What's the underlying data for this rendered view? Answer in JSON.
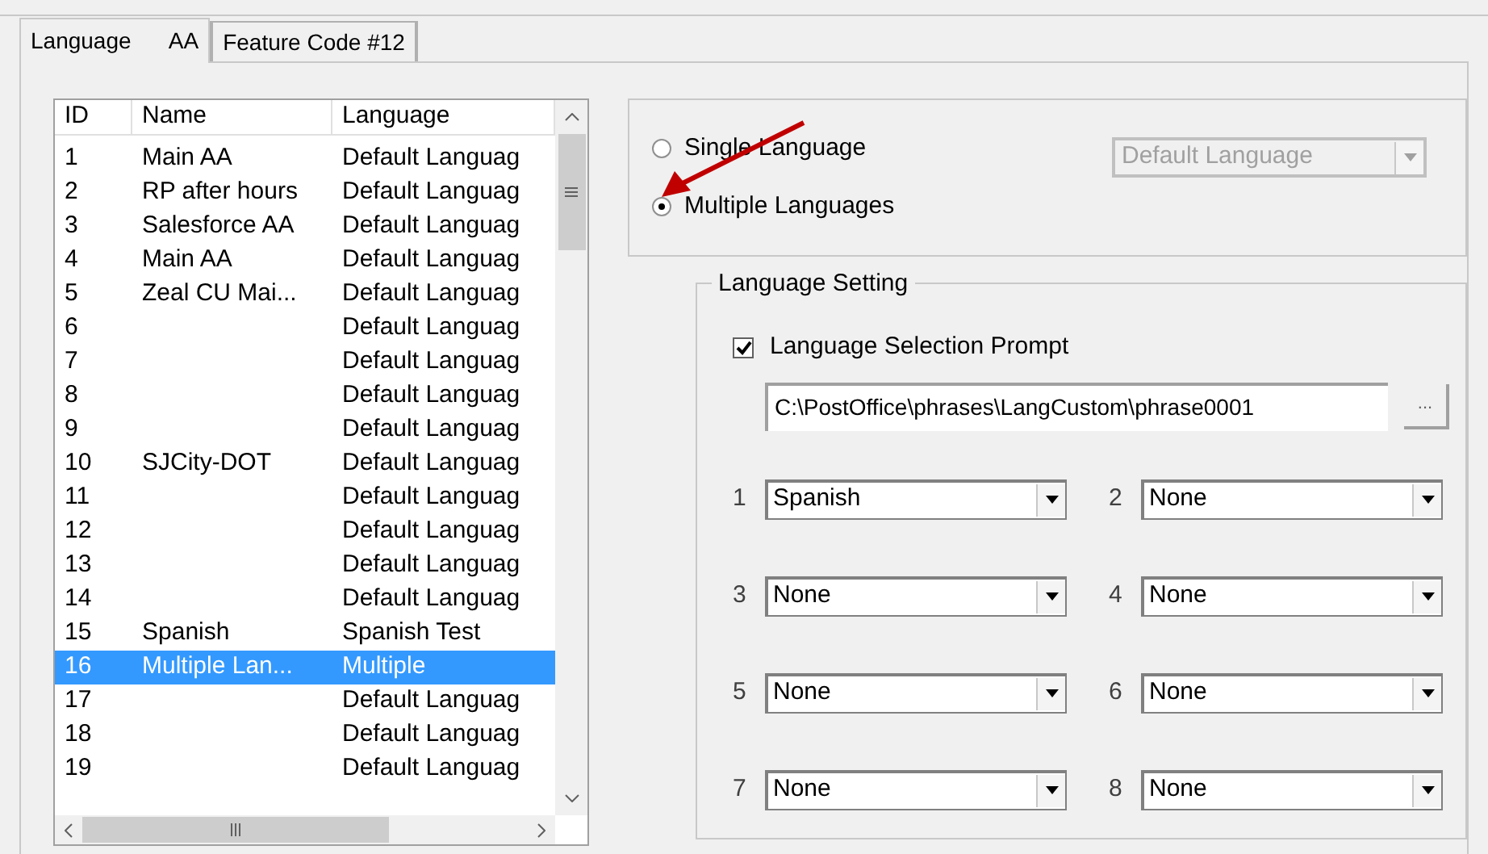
{
  "tabs": [
    {
      "label": "Language AA",
      "selected": true
    },
    {
      "label": "Feature Code #12",
      "selected": false
    }
  ],
  "list": {
    "columns": [
      "ID",
      "Name",
      "Language"
    ],
    "rows": [
      {
        "id": "1",
        "name": "Main AA",
        "language": "Default Languag",
        "selected": false
      },
      {
        "id": "2",
        "name": "RP after hours",
        "language": "Default Languag",
        "selected": false
      },
      {
        "id": "3",
        "name": "Salesforce AA",
        "language": "Default Languag",
        "selected": false
      },
      {
        "id": "4",
        "name": "Main AA",
        "language": "Default Languag",
        "selected": false
      },
      {
        "id": "5",
        "name": "Zeal CU Mai...",
        "language": "Default Languag",
        "selected": false
      },
      {
        "id": "6",
        "name": "",
        "language": "Default Languag",
        "selected": false
      },
      {
        "id": "7",
        "name": "",
        "language": "Default Languag",
        "selected": false
      },
      {
        "id": "8",
        "name": "",
        "language": "Default Languag",
        "selected": false
      },
      {
        "id": "9",
        "name": "",
        "language": "Default Languag",
        "selected": false
      },
      {
        "id": "10",
        "name": "SJCity-DOT",
        "language": "Default Languag",
        "selected": false
      },
      {
        "id": "11",
        "name": "",
        "language": "Default Languag",
        "selected": false
      },
      {
        "id": "12",
        "name": "",
        "language": "Default Languag",
        "selected": false
      },
      {
        "id": "13",
        "name": "",
        "language": "Default Languag",
        "selected": false
      },
      {
        "id": "14",
        "name": "",
        "language": "Default Languag",
        "selected": false
      },
      {
        "id": "15",
        "name": "Spanish",
        "language": "Spanish Test",
        "selected": false
      },
      {
        "id": "16",
        "name": "Multiple Lan...",
        "language": "Multiple",
        "selected": true
      },
      {
        "id": "17",
        "name": "",
        "language": "Default Languag",
        "selected": false
      },
      {
        "id": "18",
        "name": "",
        "language": "Default Languag",
        "selected": false
      },
      {
        "id": "19",
        "name": "",
        "language": "Default Languag",
        "selected": false
      }
    ]
  },
  "mode": {
    "options": [
      {
        "label": "Single Language",
        "selected": false
      },
      {
        "label": "Multiple Languages",
        "selected": true
      }
    ],
    "single_language_dropdown": {
      "value": "Default Language",
      "disabled": true
    }
  },
  "language_setting": {
    "title": "Language Setting",
    "prompt_checkbox": {
      "label": "Language Selection Prompt",
      "checked": true
    },
    "prompt_path": "C:\\PostOffice\\phrases\\LangCustom\\phrase0001",
    "browse_button": "...",
    "slots": [
      {
        "number": "1",
        "value": "Spanish"
      },
      {
        "number": "2",
        "value": "None"
      },
      {
        "number": "3",
        "value": "None"
      },
      {
        "number": "4",
        "value": "None"
      },
      {
        "number": "5",
        "value": "None"
      },
      {
        "number": "6",
        "value": "None"
      },
      {
        "number": "7",
        "value": "None"
      },
      {
        "number": "8",
        "value": "None"
      }
    ]
  }
}
